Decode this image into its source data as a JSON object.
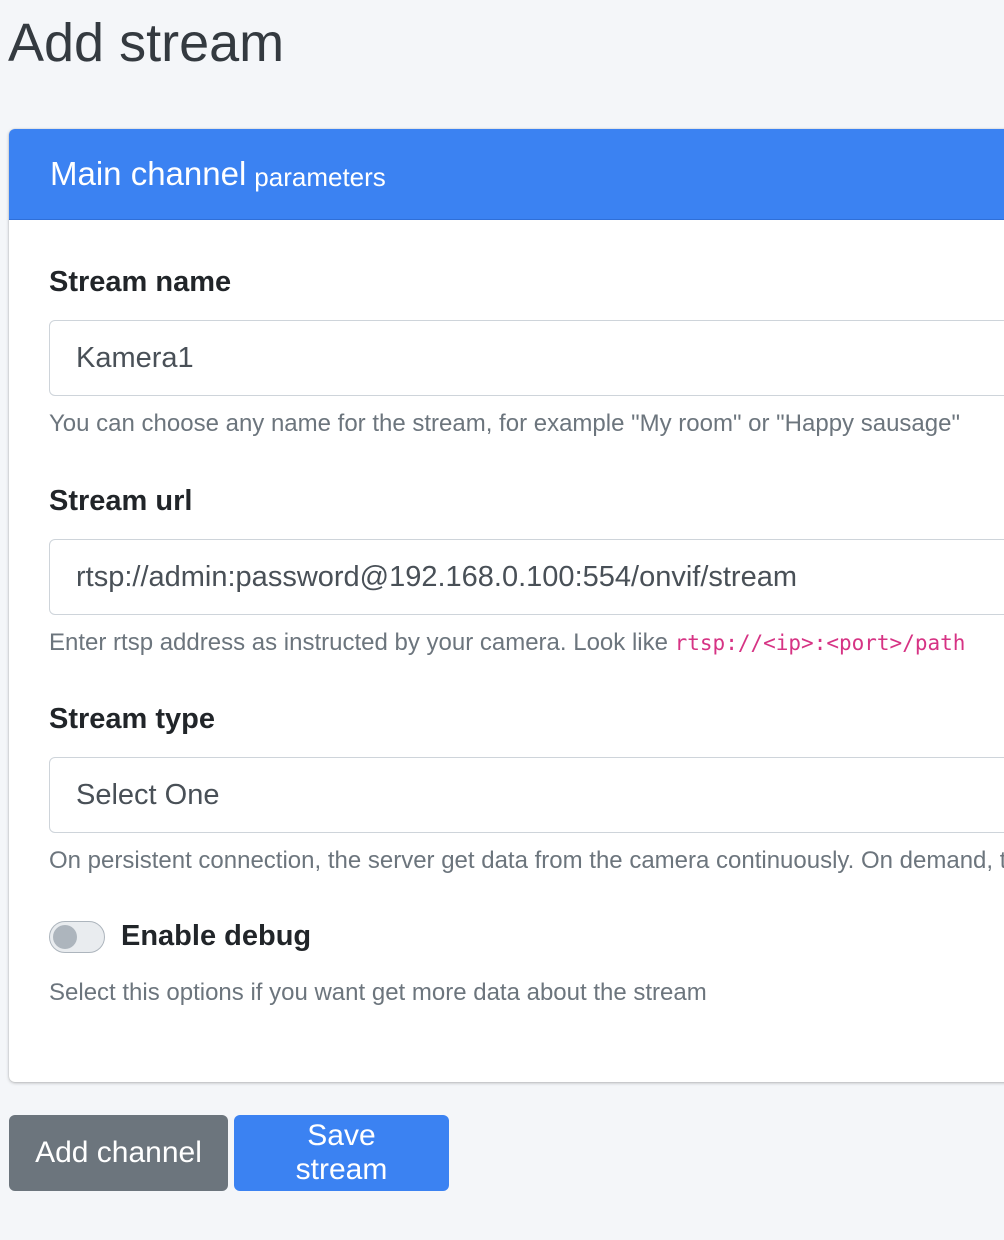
{
  "page": {
    "title": "Add stream"
  },
  "card": {
    "title_main": "Main channel",
    "title_sub": "parameters"
  },
  "fields": {
    "stream_name": {
      "label": "Stream name",
      "value": "Kamera1",
      "help": "You can choose any name for the stream, for example \"My room\" or \"Happy sausage\""
    },
    "stream_url": {
      "label": "Stream url",
      "value": "rtsp://admin:password@192.168.0.100:554/onvif/stream",
      "help": "Enter rtsp address as instructed by your camera. Look like ",
      "help_code": "rtsp://<ip>:<port>/path"
    },
    "stream_type": {
      "label": "Stream type",
      "selected": "Select One",
      "help": "On persistent connection, the server get data from the camera continuously. On demand, t"
    },
    "debug": {
      "label": "Enable debug",
      "enabled": false,
      "help": "Select this options if you want get more data about the stream"
    }
  },
  "buttons": {
    "add_channel": "Add channel",
    "save_stream": "Save stream"
  },
  "colors": {
    "primary": "#3b82f2",
    "secondary": "#6c757d",
    "code": "#d63384",
    "background": "#f4f6f9"
  }
}
